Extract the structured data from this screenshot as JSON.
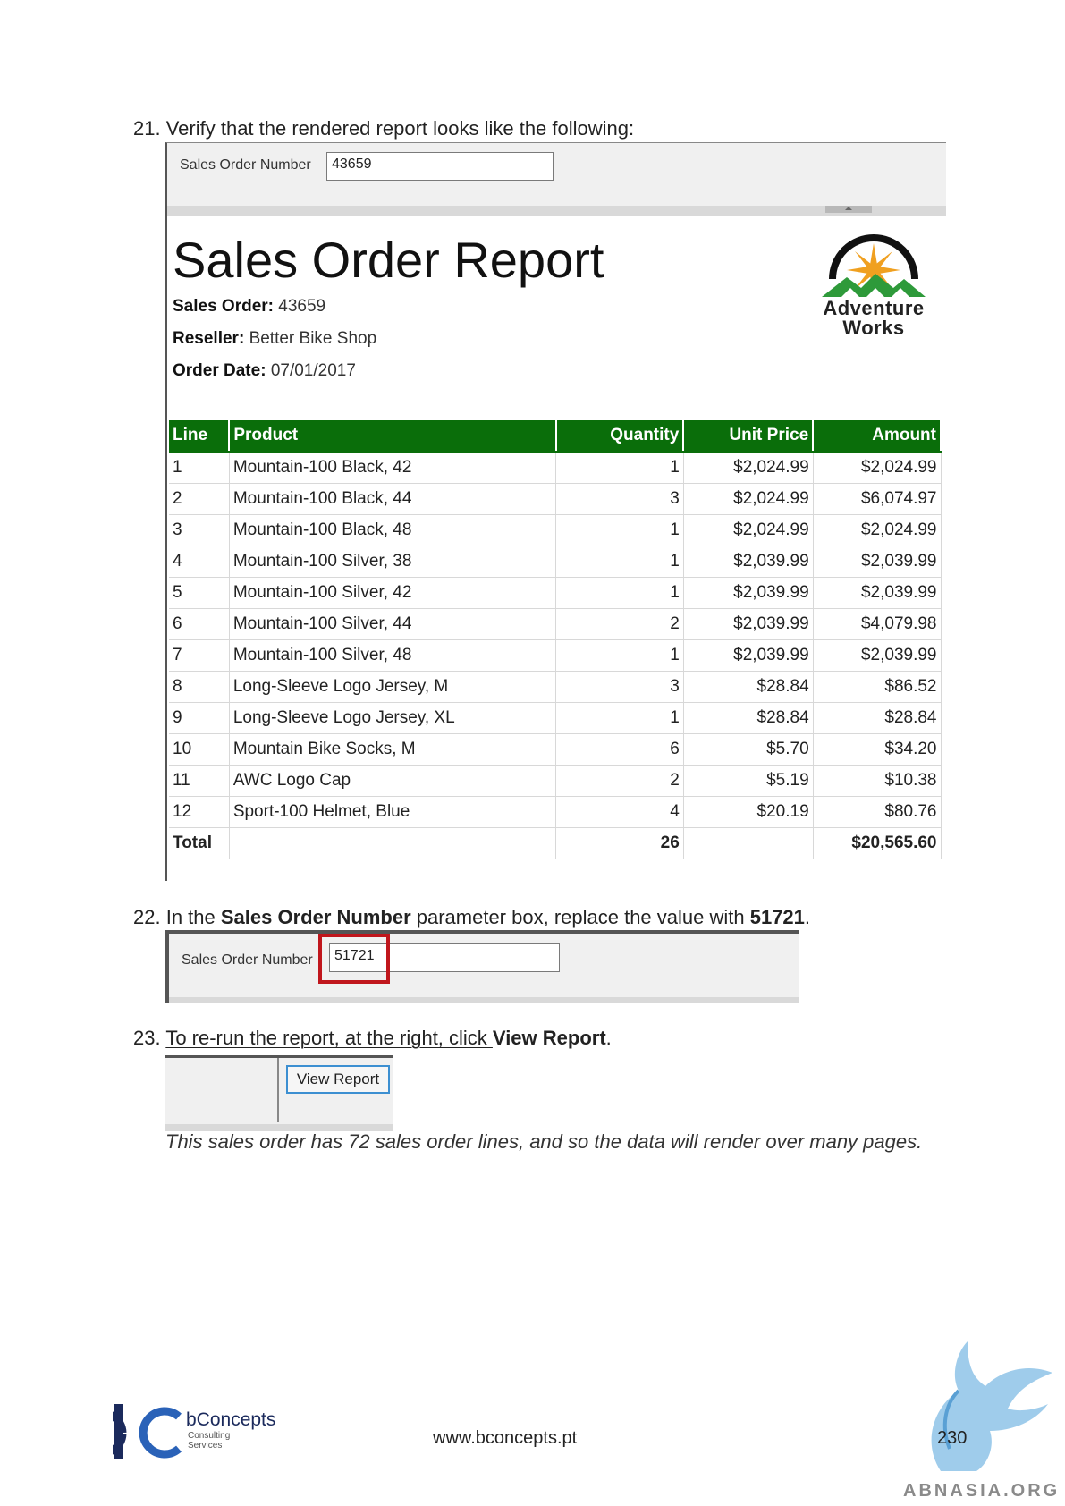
{
  "steps": {
    "s21": {
      "num": "21.",
      "text": "Verify that the rendered report looks like the following:"
    },
    "s22": {
      "num": "22.",
      "pre": "In the ",
      "bold1": "Sales Order Number",
      "mid": " parameter box, replace the value with ",
      "bold2": "51721",
      "post": "."
    },
    "s23": {
      "num": "23.",
      "pre": "To re-run the report, at the right, click ",
      "bold": "View Report",
      "post": "."
    }
  },
  "screenshot1": {
    "param_label": "Sales Order Number",
    "param_value": "43659",
    "report_title": "Sales Order Report",
    "meta": [
      {
        "label": "Sales Order:",
        "value": "43659"
      },
      {
        "label": "Reseller:",
        "value": "Better Bike Shop"
      },
      {
        "label": "Order Date:",
        "value": "07/01/2017"
      }
    ],
    "logo": {
      "line1": "Adventure",
      "line2": "Works"
    },
    "table": {
      "headers": [
        "Line",
        "Product",
        "Quantity",
        "Unit Price",
        "Amount"
      ],
      "rows": [
        [
          "1",
          "Mountain-100 Black, 42",
          "1",
          "$2,024.99",
          "$2,024.99"
        ],
        [
          "2",
          "Mountain-100 Black, 44",
          "3",
          "$2,024.99",
          "$6,074.97"
        ],
        [
          "3",
          "Mountain-100 Black, 48",
          "1",
          "$2,024.99",
          "$2,024.99"
        ],
        [
          "4",
          "Mountain-100 Silver, 38",
          "1",
          "$2,039.99",
          "$2,039.99"
        ],
        [
          "5",
          "Mountain-100 Silver, 42",
          "1",
          "$2,039.99",
          "$2,039.99"
        ],
        [
          "6",
          "Mountain-100 Silver, 44",
          "2",
          "$2,039.99",
          "$4,079.98"
        ],
        [
          "7",
          "Mountain-100 Silver, 48",
          "1",
          "$2,039.99",
          "$2,039.99"
        ],
        [
          "8",
          "Long-Sleeve Logo Jersey, M",
          "3",
          "$28.84",
          "$86.52"
        ],
        [
          "9",
          "Long-Sleeve Logo Jersey, XL",
          "1",
          "$28.84",
          "$28.84"
        ],
        [
          "10",
          "Mountain Bike Socks, M",
          "6",
          "$5.70",
          "$34.20"
        ],
        [
          "11",
          "AWC Logo Cap",
          "2",
          "$5.19",
          "$10.38"
        ],
        [
          "12",
          "Sport-100 Helmet, Blue",
          "4",
          "$20.19",
          "$80.76"
        ]
      ],
      "total": {
        "label": "Total",
        "quantity": "26",
        "amount": "$20,565.60"
      }
    }
  },
  "screenshot2": {
    "param_label": "Sales Order Number",
    "param_value": "51721"
  },
  "screenshot3": {
    "button_label": "View Report"
  },
  "note": "This sales order has 72 sales order lines, and so the data will render over many pages.",
  "footer": {
    "company": "bConcepts",
    "company_sub1": "Consulting",
    "company_sub2": "Services",
    "url": "www.bconcepts.pt",
    "page_number": "230",
    "watermark": "ABNASIA.ORG"
  },
  "colors": {
    "header_green": "#0a6e0a",
    "highlight_red": "#c0161c",
    "button_blue": "#3c8fd1",
    "brand_navy": "#1b2a5c"
  }
}
